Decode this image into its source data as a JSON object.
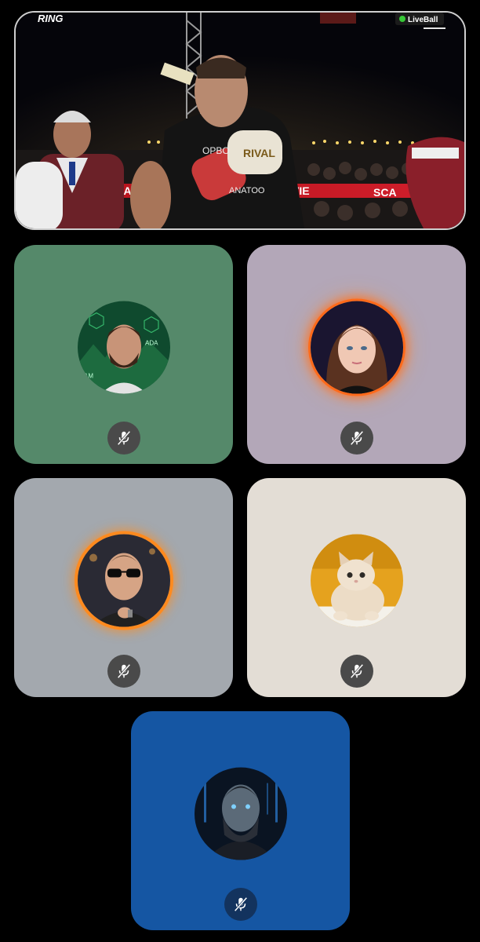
{
  "screen_share": {
    "broadcast_logo": "RING",
    "live_badge": "LiveBall",
    "shirt_text_top": "OPBO",
    "shirt_text_bottom": "H\nANATOO",
    "glove_text": "RIVAL",
    "ring_ad_text_left": "SCA",
    "ring_ad_text_mid": "VIE",
    "ring_ad_text_right": "SCA"
  },
  "participants": [
    {
      "tile_color": "#55896a",
      "avatar": "bearded-man-avatar",
      "avatar_ring": "none",
      "mic": "muted",
      "avatar_text_a": "ADA",
      "avatar_text_b": "AM"
    },
    {
      "tile_color": "#b3a7b8",
      "avatar": "woman-avatar",
      "avatar_ring": "orange-sparks",
      "mic": "muted"
    },
    {
      "tile_color": "#a3a8ae",
      "avatar": "sunglasses-man-avatar",
      "avatar_ring": "orange-glow",
      "mic": "muted"
    },
    {
      "tile_color": "#e3ddd5",
      "avatar": "kitten-avatar",
      "avatar_ring": "none",
      "mic": "muted"
    },
    {
      "tile_color": "#1556a3",
      "avatar": "warrior-avatar",
      "avatar_ring": "none",
      "mic": "muted"
    }
  ],
  "colors": {
    "background": "#000000",
    "mute_button": "#4a4a4a",
    "mute_button_dark": "#13335e"
  }
}
